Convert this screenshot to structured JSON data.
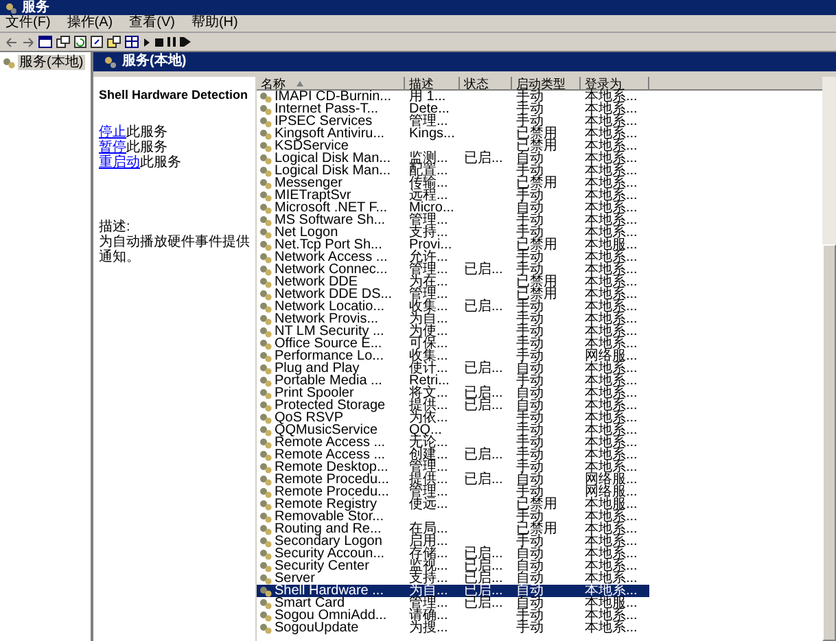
{
  "window": {
    "title": "服务"
  },
  "menu": [
    {
      "label": "文件(F)"
    },
    {
      "label": "操作(A)"
    },
    {
      "label": "查看(V)"
    },
    {
      "label": "帮助(H)"
    }
  ],
  "tree": [
    {
      "label": "服务(本地)",
      "selected": true
    }
  ],
  "header": {
    "title": "服务(本地)"
  },
  "details": {
    "service_name": "Shell Hardware Detection",
    "actions": [
      {
        "link": "停止",
        "text": "此服务"
      },
      {
        "link": "暂停",
        "text": "此服务"
      },
      {
        "link": "重启动",
        "text": "此服务"
      }
    ],
    "description_label": "描述:",
    "description": "为自动播放硬件事件提供通知。"
  },
  "list": {
    "columns": [
      {
        "label": "名称",
        "sorted": true
      },
      {
        "label": "描述",
        "sorted": false
      },
      {
        "label": "状态",
        "sorted": false
      },
      {
        "label": "启动类型",
        "sorted": false
      },
      {
        "label": "登录为",
        "sorted": false
      }
    ],
    "rows": [
      {
        "name": "IMAPI CD-Burnin...",
        "description": "用 1...",
        "status": "",
        "startup_type": "手动",
        "log_on_as": "本地系...",
        "selected": false
      },
      {
        "name": "Internet Pass-T...",
        "description": "Dete...",
        "status": "",
        "startup_type": "手动",
        "log_on_as": "本地系...",
        "selected": false
      },
      {
        "name": "IPSEC Services",
        "description": "管理...",
        "status": "",
        "startup_type": "手动",
        "log_on_as": "本地系...",
        "selected": false
      },
      {
        "name": "Kingsoft Antiviru...",
        "description": "Kings...",
        "status": "",
        "startup_type": "已禁用",
        "log_on_as": "本地系...",
        "selected": false
      },
      {
        "name": "KSDService",
        "description": "",
        "status": "",
        "startup_type": "已禁用",
        "log_on_as": "本地系...",
        "selected": false
      },
      {
        "name": "Logical Disk Man...",
        "description": "监测...",
        "status": "已启...",
        "startup_type": "自动",
        "log_on_as": "本地系...",
        "selected": false
      },
      {
        "name": "Logical Disk Man...",
        "description": "配置...",
        "status": "",
        "startup_type": "手动",
        "log_on_as": "本地系...",
        "selected": false
      },
      {
        "name": "Messenger",
        "description": "传输...",
        "status": "",
        "startup_type": "已禁用",
        "log_on_as": "本地系...",
        "selected": false
      },
      {
        "name": "MIETraptSvr",
        "description": "远程...",
        "status": "",
        "startup_type": "手动",
        "log_on_as": "本地系...",
        "selected": false
      },
      {
        "name": "Microsoft .NET F...",
        "description": "Micro...",
        "status": "",
        "startup_type": "自动",
        "log_on_as": "本地系...",
        "selected": false
      },
      {
        "name": "MS Software Sh...",
        "description": "管理...",
        "status": "",
        "startup_type": "手动",
        "log_on_as": "本地系...",
        "selected": false
      },
      {
        "name": "Net Logon",
        "description": "支持...",
        "status": "",
        "startup_type": "手动",
        "log_on_as": "本地系...",
        "selected": false
      },
      {
        "name": "Net.Tcp Port Sh...",
        "description": "Provi...",
        "status": "",
        "startup_type": "已禁用",
        "log_on_as": "本地服...",
        "selected": false
      },
      {
        "name": "Network Access ...",
        "description": "允许...",
        "status": "",
        "startup_type": "手动",
        "log_on_as": "本地系...",
        "selected": false
      },
      {
        "name": "Network Connec...",
        "description": "管理...",
        "status": "已启...",
        "startup_type": "手动",
        "log_on_as": "本地系...",
        "selected": false
      },
      {
        "name": "Network DDE",
        "description": "为在...",
        "status": "",
        "startup_type": "已禁用",
        "log_on_as": "本地系...",
        "selected": false
      },
      {
        "name": "Network DDE DS...",
        "description": "管理...",
        "status": "",
        "startup_type": "已禁用",
        "log_on_as": "本地系...",
        "selected": false
      },
      {
        "name": "Network Locatio...",
        "description": "收集...",
        "status": "已启...",
        "startup_type": "手动",
        "log_on_as": "本地系...",
        "selected": false
      },
      {
        "name": "Network Provis...",
        "description": "为自...",
        "status": "",
        "startup_type": "手动",
        "log_on_as": "本地系...",
        "selected": false
      },
      {
        "name": "NT LM Security ...",
        "description": "为使...",
        "status": "",
        "startup_type": "手动",
        "log_on_as": "本地系...",
        "selected": false
      },
      {
        "name": "Office Source E...",
        "description": "可保...",
        "status": "",
        "startup_type": "手动",
        "log_on_as": "本地系...",
        "selected": false
      },
      {
        "name": "Performance Lo...",
        "description": "收集...",
        "status": "",
        "startup_type": "手动",
        "log_on_as": "网络服...",
        "selected": false
      },
      {
        "name": "Plug and Play",
        "description": "使计...",
        "status": "已启...",
        "startup_type": "自动",
        "log_on_as": "本地系...",
        "selected": false
      },
      {
        "name": "Portable Media ...",
        "description": "Retri...",
        "status": "",
        "startup_type": "手动",
        "log_on_as": "本地系...",
        "selected": false
      },
      {
        "name": "Print Spooler",
        "description": "将文...",
        "status": "已启...",
        "startup_type": "自动",
        "log_on_as": "本地系...",
        "selected": false
      },
      {
        "name": "Protected Storage",
        "description": "提供...",
        "status": "已启...",
        "startup_type": "自动",
        "log_on_as": "本地系...",
        "selected": false
      },
      {
        "name": "QoS RSVP",
        "description": "为依...",
        "status": "",
        "startup_type": "手动",
        "log_on_as": "本地系...",
        "selected": false
      },
      {
        "name": "QQMusicService",
        "description": "QQ...",
        "status": "",
        "startup_type": "手动",
        "log_on_as": "本地系...",
        "selected": false
      },
      {
        "name": "Remote Access ...",
        "description": "无论...",
        "status": "",
        "startup_type": "手动",
        "log_on_as": "本地系...",
        "selected": false
      },
      {
        "name": "Remote Access ...",
        "description": "创建...",
        "status": "已启...",
        "startup_type": "手动",
        "log_on_as": "本地系...",
        "selected": false
      },
      {
        "name": "Remote Desktop...",
        "description": "管理...",
        "status": "",
        "startup_type": "手动",
        "log_on_as": "本地系...",
        "selected": false
      },
      {
        "name": "Remote Procedu...",
        "description": "提供...",
        "status": "已启...",
        "startup_type": "自动",
        "log_on_as": "网络服...",
        "selected": false
      },
      {
        "name": "Remote Procedu...",
        "description": "管理...",
        "status": "",
        "startup_type": "手动",
        "log_on_as": "网络服...",
        "selected": false
      },
      {
        "name": "Remote Registry",
        "description": "使远...",
        "status": "",
        "startup_type": "已禁用",
        "log_on_as": "本地服...",
        "selected": false
      },
      {
        "name": "Removable Stor...",
        "description": "",
        "status": "",
        "startup_type": "手动",
        "log_on_as": "本地系...",
        "selected": false
      },
      {
        "name": "Routing and Re...",
        "description": "在局...",
        "status": "",
        "startup_type": "已禁用",
        "log_on_as": "本地系...",
        "selected": false
      },
      {
        "name": "Secondary Logon",
        "description": "启用...",
        "status": "",
        "startup_type": "手动",
        "log_on_as": "本地系...",
        "selected": false
      },
      {
        "name": "Security Accoun...",
        "description": "存储...",
        "status": "已启...",
        "startup_type": "自动",
        "log_on_as": "本地系...",
        "selected": false
      },
      {
        "name": "Security Center",
        "description": "监视...",
        "status": "已启...",
        "startup_type": "自动",
        "log_on_as": "本地系...",
        "selected": false
      },
      {
        "name": "Server",
        "description": "支持...",
        "status": "已启...",
        "startup_type": "自动",
        "log_on_as": "本地系...",
        "selected": false
      },
      {
        "name": "Shell Hardware ...",
        "description": "为自...",
        "status": "已启...",
        "startup_type": "自动",
        "log_on_as": "本地系...",
        "selected": true
      },
      {
        "name": "Smart Card",
        "description": "管理...",
        "status": "已启...",
        "startup_type": "自动",
        "log_on_as": "本地服...",
        "selected": false
      },
      {
        "name": "Sogou OmniAdd...",
        "description": "请确...",
        "status": "",
        "startup_type": "手动",
        "log_on_as": "本地系...",
        "selected": false
      },
      {
        "name": "SogouUpdate",
        "description": "为搜...",
        "status": "",
        "startup_type": "手动",
        "log_on_as": "本地系...",
        "selected": false
      }
    ]
  }
}
